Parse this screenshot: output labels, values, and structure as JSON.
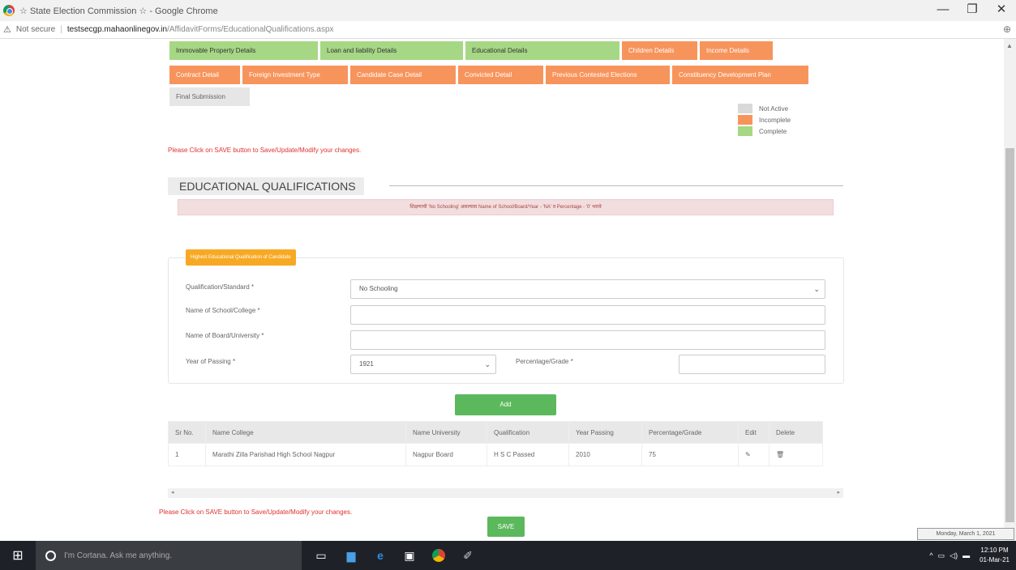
{
  "browser": {
    "window_title": "☆ State Election Commission ☆ - Google Chrome",
    "security": "Not secure",
    "url_host": "testsecgp.mahaonlinegov.in",
    "url_path": "/AffidavitForms/EducationalQualifications.aspx",
    "controls": [
      "—",
      "❐",
      "✕"
    ]
  },
  "tabs_row1": [
    {
      "label": "Immovable Property Details",
      "status": "complete"
    },
    {
      "label": "Loan and liability Details",
      "status": "complete"
    },
    {
      "label": "Educational Details",
      "status": "complete"
    },
    {
      "label": "Children Details",
      "status": "incomplete"
    },
    {
      "label": "Income Details",
      "status": "incomplete"
    }
  ],
  "tabs_row2": [
    {
      "label": "Contract Detail",
      "status": "incomplete"
    },
    {
      "label": "Foreign Investment Type",
      "status": "incomplete"
    },
    {
      "label": "Candidate Case Detail",
      "status": "incomplete"
    },
    {
      "label": "Convicted Detail",
      "status": "incomplete"
    },
    {
      "label": "Previous Contested Elections",
      "status": "incomplete"
    },
    {
      "label": "Constituency Development Plan",
      "status": "incomplete"
    }
  ],
  "tabs_row3": [
    {
      "label": "Final Submission",
      "status": "not-active"
    }
  ],
  "legend": [
    {
      "label": "Not Active",
      "color": "#d9d9d9"
    },
    {
      "label": "Incomplete",
      "color": "#f7945c"
    },
    {
      "label": "Complete",
      "color": "#a6d785"
    }
  ],
  "save_message": "Please Click on SAVE button to Save/Update/Modify your changes.",
  "section_title": "EDUCATIONAL QUALIFICATIONS",
  "alert_text": "शिक्षणाची 'No Schooling' असल्यास Name of School/Board/Year - 'NA' व Percentage - '0' भरावे",
  "fieldset_legend": "Highest Educational Qualification of Candidate",
  "form": {
    "qualification_label": "Qualification/Standard *",
    "qualification_value": "No Schooling",
    "school_label": "Name of School/College *",
    "school_value": "",
    "board_label": "Name of Board/University *",
    "board_value": "",
    "year_label": "Year of Passing *",
    "year_value": "1921",
    "percentage_label": "Percentage/Grade *",
    "percentage_value": ""
  },
  "add_label": "Add",
  "table": {
    "headers": [
      "Sr No.",
      "Name College",
      "Name University",
      "Qualification",
      "Year Passing",
      "Percentage/Grade",
      "Edit",
      "Delete"
    ],
    "rows": [
      [
        "1",
        "Marathi Zilla Parishad High School Nagpur",
        "Nagpur Board",
        "H S C Passed",
        "2010",
        "75"
      ]
    ]
  },
  "save_label": "SAVE",
  "tooltip_date": "Monday, March 1, 2021",
  "taskbar": {
    "cortana_placeholder": "I'm Cortana. Ask me anything.",
    "time": "12:10 PM",
    "date": "01-Mar-21"
  }
}
